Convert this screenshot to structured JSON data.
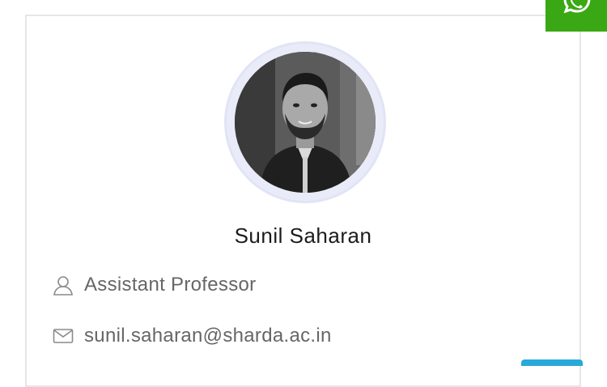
{
  "profile": {
    "name": "Sunil Saharan",
    "designation": "Assistant Professor",
    "email": "sunil.saharan@sharda.ac.in"
  },
  "icons": {
    "photo": "profile-photo",
    "designation": "user-icon",
    "email": "mail-icon",
    "whatsapp": "whatsapp-icon"
  },
  "colors": {
    "whatsapp_green": "#3aa814",
    "accent_blue": "#29a9d9",
    "ring": "#e1e4f6",
    "text_dark": "#1c1c1c",
    "text_muted": "#666666"
  }
}
